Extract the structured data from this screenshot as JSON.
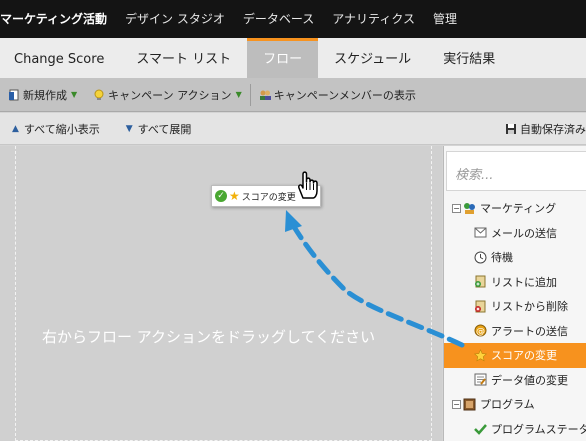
{
  "topnav": {
    "items": [
      "マーケティング活動",
      "デザイン スタジオ",
      "データベース",
      "アナリティクス",
      "管理"
    ]
  },
  "tabs": {
    "items": [
      "Change Score",
      "スマート リスト",
      "フロー",
      "スケジュール",
      "実行結果"
    ],
    "active_index": 2,
    "accent_color": "#f7921e"
  },
  "toolbar": {
    "new_label": "新規作成",
    "campaign_action_label": "キャンペーン アクション",
    "members_label": "キャンペーンメンバーの表示"
  },
  "subbar": {
    "collapse_label": "すべて縮小表示",
    "expand_label": "すべて展開",
    "autosave_label": "自動保存済み"
  },
  "canvas": {
    "drop_hint": "右からフロー アクションをドラッグしてください",
    "drag_card_label": "スコアの変更"
  },
  "palette": {
    "search_placeholder": "検索...",
    "groups": [
      {
        "label": "マーケティング",
        "items": [
          {
            "label": "メールの送信",
            "icon": "email-icon"
          },
          {
            "label": "待機",
            "icon": "clock-icon"
          },
          {
            "label": "リストに追加",
            "icon": "list-add-icon"
          },
          {
            "label": "リストから削除",
            "icon": "list-remove-icon"
          },
          {
            "label": "アラートの送信",
            "icon": "alert-icon"
          },
          {
            "label": "スコアの変更",
            "icon": "star-icon",
            "active": true
          },
          {
            "label": "データ値の変更",
            "icon": "data-edit-icon"
          }
        ]
      },
      {
        "label": "プログラム",
        "items": [
          {
            "label": "プログラムステータス",
            "icon": "program-status-icon"
          }
        ]
      }
    ]
  }
}
